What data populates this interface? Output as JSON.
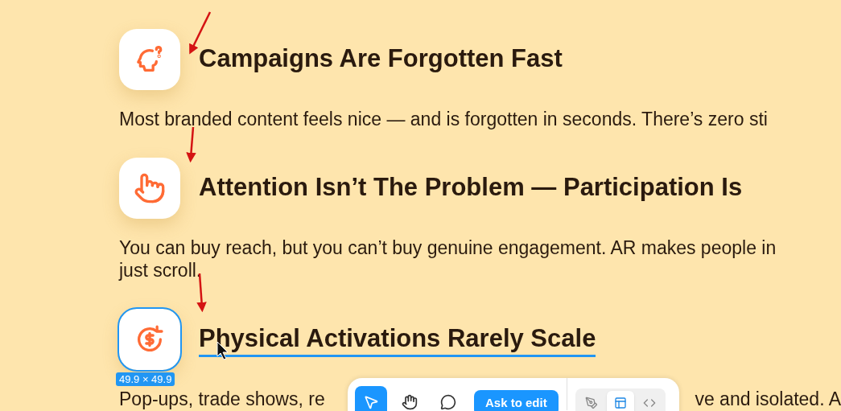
{
  "sections": [
    {
      "kind": "head-question",
      "title": "Campaigns Are Forgotten Fast",
      "selected": false,
      "body": [
        [
          "Most branded content feels nice — and is forgotten in seconds. There’s zero sti"
        ]
      ]
    },
    {
      "kind": "hand-pointer",
      "title": "Attention Isn’t The Problem — Participation Is",
      "selected": false,
      "body": [
        [
          "You can buy reach, but you can’t buy genuine engagement. AR makes people in"
        ],
        [
          "just scroll."
        ]
      ]
    },
    {
      "kind": "dollar-cycle",
      "title": "Physical Activations Rarely Scale",
      "selected": true,
      "selection_size": "49.9 × 49.9",
      "body": [
        [
          "Pop-ups, trade shows, re",
          "ve and isolated. A"
        ]
      ]
    }
  ],
  "toolbar": {
    "tools": [
      {
        "kind": "select",
        "selected": true
      },
      {
        "kind": "hand",
        "selected": false
      },
      {
        "kind": "comment",
        "selected": false
      }
    ],
    "action": "Ask to edit",
    "views": [
      {
        "kind": "draw",
        "selected": false
      },
      {
        "kind": "design",
        "selected": true
      },
      {
        "kind": "code",
        "selected": false
      }
    ]
  }
}
